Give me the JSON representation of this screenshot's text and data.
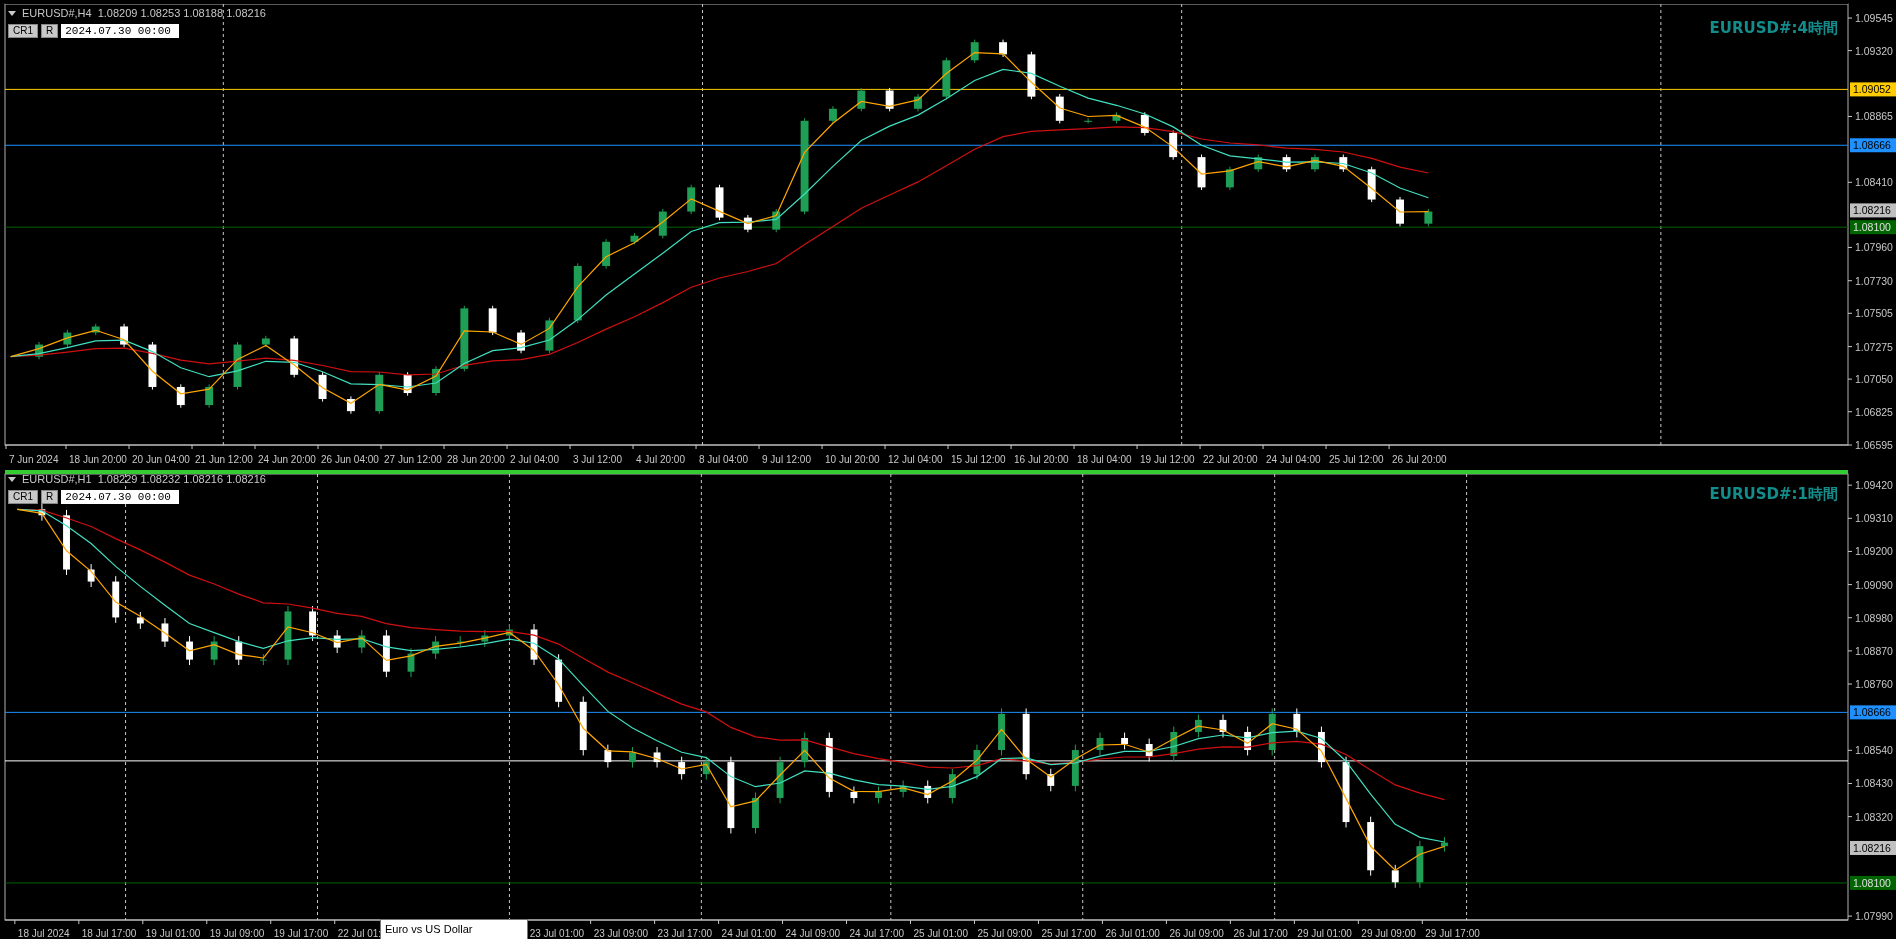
{
  "charts": [
    {
      "symbol": "EURUSD#,H4",
      "ohlc": "1.08209 1.08253 1.08188 1.08216",
      "buttons": [
        "CR1",
        "R"
      ],
      "date_field": "2024.07.30 00:00",
      "title": "EURUSD#:4時間",
      "active": false,
      "price_axis_labels": [
        "1.09545",
        "1.09320",
        "1.08865",
        "1.08410",
        "1.07960",
        "1.07730",
        "1.07505",
        "1.07275",
        "1.07050",
        "1.06825",
        "1.06595"
      ],
      "price_tags": [
        {
          "label": "1.09052",
          "color": "#ffcc00",
          "kind": "line"
        },
        {
          "label": "1.08666",
          "color": "#1e90ff",
          "kind": "line"
        },
        {
          "label": "1.08216",
          "color": "#c0c0c0",
          "kind": "bid"
        },
        {
          "label": "1.08100",
          "color": "#006400",
          "kind": "line"
        }
      ],
      "time_axis_labels": [
        "7 Jun 2024",
        "18 Jun 20:00",
        "20 Jun 04:00",
        "21 Jun 12:00",
        "24 Jun 20:00",
        "26 Jun 04:00",
        "27 Jun 12:00",
        "28 Jun 20:00",
        "2 Jul 04:00",
        "3 Jul 12:00",
        "4 Jul 20:00",
        "8 Jul 04:00",
        "9 Jul 12:00",
        "10 Jul 20:00",
        "12 Jul 04:00",
        "15 Jul 12:00",
        "16 Jul 20:00",
        "18 Jul 04:00",
        "19 Jul 12:00",
        "22 Jul 20:00",
        "24 Jul 04:00",
        "25 Jul 12:00",
        "26 Jul 20:00"
      ]
    },
    {
      "symbol": "EURUSD#,H1",
      "ohlc": "1.08229 1.08232 1.08216 1.08216",
      "buttons": [
        "CR1",
        "R"
      ],
      "date_field": "2024.07.30 00:00",
      "title": "EURUSD#:1時間",
      "active": true,
      "price_axis_labels": [
        "1.09420",
        "1.09310",
        "1.09200",
        "1.09090",
        "1.08980",
        "1.08870",
        "1.08760",
        "1.08540",
        "1.08430",
        "1.08320",
        "1.07990"
      ],
      "price_tags": [
        {
          "label": "1.08666",
          "color": "#1e90ff",
          "kind": "line"
        },
        {
          "label": "1.08216",
          "color": "#c0c0c0",
          "kind": "bid"
        },
        {
          "label": "1.08100",
          "color": "#006400",
          "kind": "line"
        }
      ],
      "time_axis_labels": [
        "18 Jul 2024",
        "18 Jul 17:00",
        "19 Jul 01:00",
        "19 Jul 09:00",
        "19 Jul 17:00",
        "22 Jul 01:",
        "23 Jul 01:00",
        "23 Jul 09:00",
        "23 Jul 17:00",
        "24 Jul 01:00",
        "24 Jul 09:00",
        "24 Jul 17:00",
        "25 Jul 01:00",
        "25 Jul 09:00",
        "25 Jul 17:00",
        "26 Jul 01:00",
        "26 Jul 09:00",
        "26 Jul 17:00",
        "29 Jul 01:00",
        "29 Jul 09:00",
        "29 Jul 17:00"
      ]
    }
  ],
  "tooltip": "Euro vs US Dollar"
}
